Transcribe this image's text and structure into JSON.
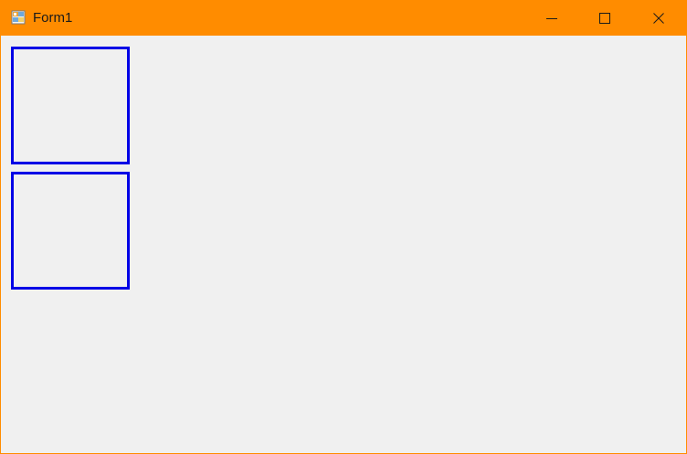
{
  "window": {
    "title": "Form1",
    "app_icon": "winforms-app-icon",
    "frame_color": "#ff8c00",
    "client_background": "#f0f0f0"
  },
  "caption_buttons": [
    {
      "name": "minimize",
      "icon": "minimize-icon"
    },
    {
      "name": "maximize",
      "icon": "maximize-icon"
    },
    {
      "name": "close",
      "icon": "close-icon"
    }
  ],
  "panels": [
    {
      "name": "panel-1",
      "border_color": "#0000e6"
    },
    {
      "name": "panel-2",
      "border_color": "#0000e6"
    }
  ]
}
